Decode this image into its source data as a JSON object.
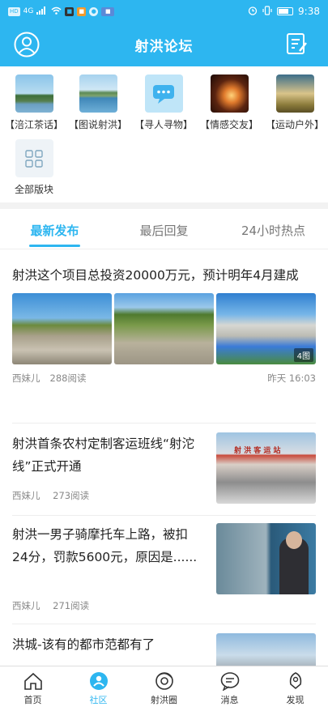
{
  "status": {
    "time": "9:38",
    "left_text": "HD",
    "net": "4G"
  },
  "header": {
    "title": "射洪论坛"
  },
  "categories": [
    {
      "label": "【涪江茶话】",
      "icon": "landscape-river-icon"
    },
    {
      "label": "【图说射洪】",
      "icon": "landscape-lake-icon"
    },
    {
      "label": "【寻人寻物】",
      "icon": "chat-bubble-icon"
    },
    {
      "label": "【情感交友】",
      "icon": "sunset-couple-icon"
    },
    {
      "label": "【运动户外】",
      "icon": "cyclist-icon"
    },
    {
      "label": "全部版块",
      "icon": "grid-icon"
    }
  ],
  "tabs": [
    "最新发布",
    "最后回复",
    "24小时热点"
  ],
  "posts": [
    {
      "title": "射洪这个项目总投资20000万元，预计明年4月建成",
      "author": "西妹儿",
      "reads": "288阅读",
      "time": "昨天 16:03",
      "img_badge": "4图"
    },
    {
      "title": "射洪首条农村定制客运班线“射沱线”正式开通",
      "author": "西妹儿",
      "reads": "273阅读",
      "img_text": "射 洪 客 运 站"
    },
    {
      "title": "射洪一男子骑摩托车上路，被扣24分，罚款5600元，原因是......",
      "author": "西妹儿",
      "reads": "271阅读"
    },
    {
      "title": "洪城-该有的都市范都有了"
    }
  ],
  "nav": [
    {
      "label": "首页",
      "icon": "home-icon"
    },
    {
      "label": "社区",
      "icon": "community-icon"
    },
    {
      "label": "射洪圈",
      "icon": "circle-icon"
    },
    {
      "label": "消息",
      "icon": "message-icon"
    },
    {
      "label": "发现",
      "icon": "discover-icon"
    }
  ],
  "colors": {
    "accent": "#2db6f0"
  }
}
